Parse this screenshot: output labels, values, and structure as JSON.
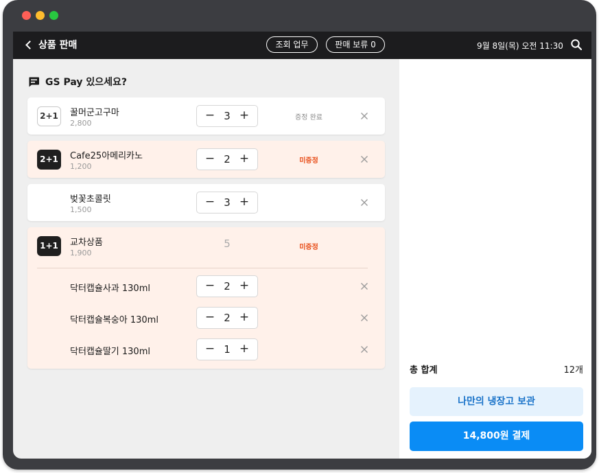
{
  "window": {
    "buttons": [
      {
        "name": "close",
        "color": "#ff5f57"
      },
      {
        "name": "minimize",
        "color": "#febc2e"
      },
      {
        "name": "maximize",
        "color": "#28c840"
      }
    ]
  },
  "header": {
    "title": "상품 판매",
    "inquiry_label": "조회 업무",
    "hold_label": "판매 보류 0",
    "datetime": "9월 8일(목) 오전 11:30"
  },
  "promo": {
    "text": "GS Pay 있으세요?"
  },
  "items": [
    {
      "badge": "2+1",
      "name": "꿀머군고구마",
      "price": "2,800",
      "qty": "3",
      "status": "증정 완료"
    },
    {
      "badge": "2+1",
      "name": "Cafe25아메리카노",
      "price": "1,200",
      "qty": "2",
      "status": "미증정"
    },
    {
      "name": "벚꽃초콜릿",
      "price": "1,500",
      "qty": "3"
    },
    {
      "badge": "1+1",
      "name": "교차상품",
      "price": "1,900",
      "qty": "5",
      "status": "미증정",
      "sub_items": [
        {
          "name": "닥터캡슐사과 130ml",
          "qty": "2"
        },
        {
          "name": "닥터캡슐복숭아 130ml",
          "qty": "2"
        },
        {
          "name": "닥터캡슐딸기 130ml",
          "qty": "1"
        }
      ]
    }
  ],
  "stepper": {
    "minus": "−",
    "plus": "+"
  },
  "summary": {
    "total_label": "총 합계",
    "total_count": "12개",
    "fridge_label": "나만의 냉장고 보관",
    "pay_label": "14,800원 결제"
  },
  "colors": {
    "accent": "#0a8cf5",
    "pending": "#e8501c",
    "pink_card": "#fff1ea"
  }
}
